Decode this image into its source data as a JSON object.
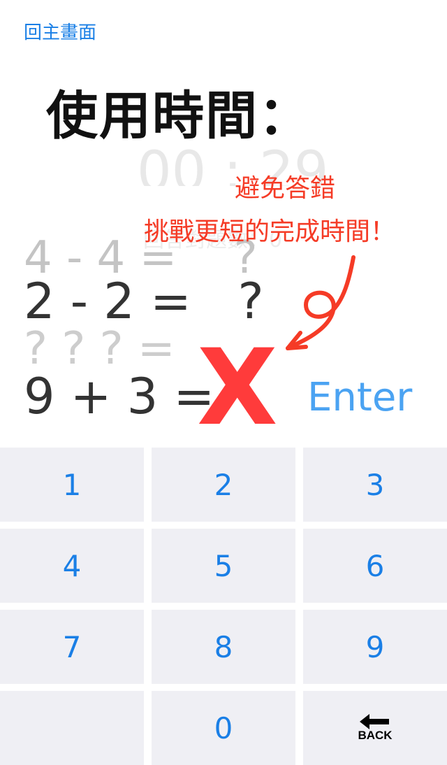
{
  "nav": {
    "back_label": "回主畫面"
  },
  "header": {
    "time_label": "使用時間：",
    "timer_value": "00 : 29"
  },
  "faint_subtext": "回答對題數：0",
  "equations": {
    "previous": "4 - 4 =    ?",
    "current": "2 - 2 =   ?",
    "next": "? ? ? =",
    "answered": "9 + 3 ="
  },
  "answer_mark": "X",
  "enter_label": "Enter",
  "annotation": {
    "line1": "避免答錯",
    "line2": "挑戰更短的完成時間！",
    "color": "#f53b26"
  },
  "keypad": {
    "keys": [
      "1",
      "2",
      "3",
      "4",
      "5",
      "6",
      "7",
      "8",
      "9",
      "0"
    ],
    "back_label": "BACK"
  },
  "colors": {
    "accent": "#1a7fe6",
    "enter": "#4ba3f2",
    "wrong": "#ff3b3b",
    "key_bg": "#efeff4"
  }
}
